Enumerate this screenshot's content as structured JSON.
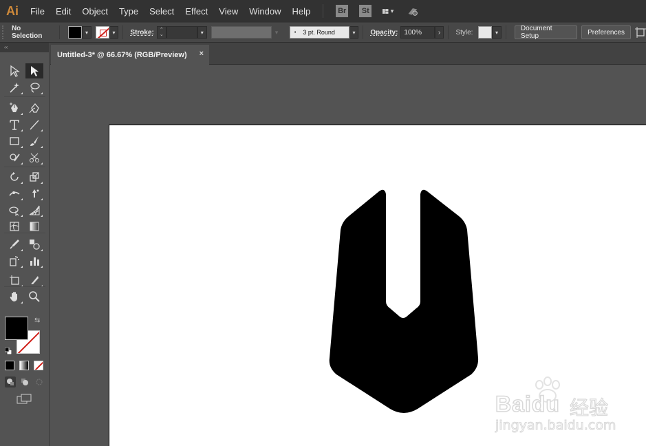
{
  "app": {
    "logo_text": "Ai",
    "brand_color": "#d08a3a"
  },
  "menu": {
    "items": [
      "File",
      "Edit",
      "Object",
      "Type",
      "Select",
      "Effect",
      "View",
      "Window",
      "Help"
    ],
    "bridge_badge": "Br",
    "stock_badge": "St"
  },
  "control_bar": {
    "selection_status": "No Selection",
    "stroke_label": "Stroke:",
    "brush_value": "3 pt. Round",
    "brush_dot": "•",
    "opacity_label": "Opacity:",
    "opacity_value": "100%",
    "style_label": "Style:",
    "document_setup_label": "Document Setup",
    "preferences_label": "Preferences",
    "fill_color": "#000000",
    "stroke_color": "none"
  },
  "tools_panel": {
    "collapse_glyph": "‹‹",
    "tools": [
      "selection-tool",
      "direct-selection-tool",
      "magic-wand-tool",
      "lasso-tool",
      "pen-tool",
      "curvature-tool",
      "type-tool",
      "line-segment-tool",
      "rectangle-tool",
      "paintbrush-tool",
      "shaper-tool",
      "scissors-tool",
      "rotate-tool",
      "scale-tool",
      "width-tool",
      "puppet-warp-tool",
      "shape-builder-tool",
      "perspective-grid-tool",
      "mesh-tool",
      "gradient-tool",
      "eyedropper-tool",
      "blend-tool",
      "symbol-sprayer-tool",
      "column-graph-tool",
      "artboard-tool",
      "slice-tool",
      "hand-tool",
      "zoom-tool"
    ]
  },
  "document": {
    "tab_title": "Untitled-3* @ 66.67% (RGB/Preview)",
    "close_glyph": "×"
  },
  "watermark": {
    "brand_text": "Bai",
    "brand_text_2": "du",
    "cn_text": "经验",
    "url_text": "jingyan.baidu.com"
  }
}
